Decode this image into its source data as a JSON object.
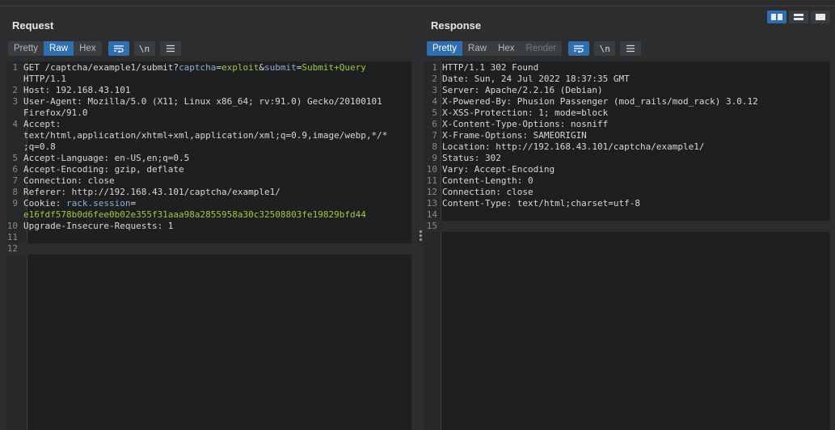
{
  "request": {
    "title": "Request",
    "tabs": [
      "Pretty",
      "Raw",
      "Hex"
    ],
    "selected_tab": "Raw",
    "wrap_icon": "wrap-lines-icon",
    "newline_label": "\\n",
    "menu_icon": "hamburger-menu-icon",
    "lines": [
      {
        "n": "1",
        "segs": [
          [
            "k",
            "GET /captcha/example1/submit?"
          ],
          [
            "pn",
            "captcha"
          ],
          [
            "k",
            "="
          ],
          [
            "pv",
            "exploit"
          ],
          [
            "k",
            "&"
          ],
          [
            "pn",
            "submit"
          ],
          [
            "k",
            "="
          ],
          [
            "pv",
            "Submit+Query"
          ]
        ]
      },
      {
        "n": "",
        "segs": [
          [
            "k",
            "HTTP/1.1"
          ]
        ]
      },
      {
        "n": "2",
        "segs": [
          [
            "k",
            "Host: 192.168.43.101"
          ]
        ]
      },
      {
        "n": "3",
        "segs": [
          [
            "k",
            "User-Agent: Mozilla/5.0 (X11; Linux x86_64; rv:91.0) Gecko/20100101"
          ]
        ]
      },
      {
        "n": "",
        "segs": [
          [
            "k",
            "Firefox/91.0"
          ]
        ]
      },
      {
        "n": "4",
        "segs": [
          [
            "k",
            "Accept:"
          ]
        ]
      },
      {
        "n": "",
        "segs": [
          [
            "k",
            "text/html,application/xhtml+xml,application/xml;q=0.9,image/webp,*/*"
          ]
        ]
      },
      {
        "n": "",
        "segs": [
          [
            "k",
            ";q=0.8"
          ]
        ]
      },
      {
        "n": "5",
        "segs": [
          [
            "k",
            "Accept-Language: en-US,en;q=0.5"
          ]
        ]
      },
      {
        "n": "6",
        "segs": [
          [
            "k",
            "Accept-Encoding: gzip, deflate"
          ]
        ]
      },
      {
        "n": "7",
        "segs": [
          [
            "k",
            "Connection: close"
          ]
        ]
      },
      {
        "n": "8",
        "segs": [
          [
            "k",
            "Referer: http://192.168.43.101/captcha/example1/"
          ]
        ]
      },
      {
        "n": "9",
        "segs": [
          [
            "k",
            "Cookie: "
          ],
          [
            "pn",
            "rack.session"
          ],
          [
            "k",
            "="
          ]
        ]
      },
      {
        "n": "",
        "segs": [
          [
            "pv",
            "e16fdf578b0d6fee0b02e355f31aaa98a2855958a30c32508803fe19829bfd44"
          ]
        ]
      },
      {
        "n": "10",
        "segs": [
          [
            "k",
            "Upgrade-Insecure-Requests: 1"
          ]
        ]
      },
      {
        "n": "11",
        "segs": []
      },
      {
        "n": "12",
        "segs": []
      }
    ]
  },
  "response": {
    "title": "Response",
    "tabs": [
      "Pretty",
      "Raw",
      "Hex",
      "Render"
    ],
    "selected_tab": "Pretty",
    "disabled_tab": "Render",
    "wrap_icon": "wrap-lines-icon",
    "newline_label": "\\n",
    "menu_icon": "hamburger-menu-icon",
    "lines": [
      {
        "n": "1",
        "segs": [
          [
            "k",
            "HTTP/1.1 302 Found"
          ]
        ]
      },
      {
        "n": "2",
        "segs": [
          [
            "k",
            "Date: Sun, 24 Jul 2022 18:37:35 GMT"
          ]
        ]
      },
      {
        "n": "3",
        "segs": [
          [
            "k",
            "Server: Apache/2.2.16 (Debian)"
          ]
        ]
      },
      {
        "n": "4",
        "segs": [
          [
            "k",
            "X-Powered-By: Phusion Passenger (mod_rails/mod_rack) 3.0.12"
          ]
        ]
      },
      {
        "n": "5",
        "segs": [
          [
            "k",
            "X-XSS-Protection: 1; mode=block"
          ]
        ]
      },
      {
        "n": "6",
        "segs": [
          [
            "k",
            "X-Content-Type-Options: nosniff"
          ]
        ]
      },
      {
        "n": "7",
        "segs": [
          [
            "k",
            "X-Frame-Options: SAMEORIGIN"
          ]
        ]
      },
      {
        "n": "8",
        "segs": [
          [
            "k",
            "Location: http://192.168.43.101/captcha/example1/"
          ]
        ]
      },
      {
        "n": "9",
        "segs": [
          [
            "k",
            "Status: 302"
          ]
        ]
      },
      {
        "n": "10",
        "segs": [
          [
            "k",
            "Vary: Accept-Encoding"
          ]
        ]
      },
      {
        "n": "11",
        "segs": [
          [
            "k",
            "Content-Length: 0"
          ]
        ]
      },
      {
        "n": "12",
        "segs": [
          [
            "k",
            "Connection: close"
          ]
        ]
      },
      {
        "n": "13",
        "segs": [
          [
            "k",
            "Content-Type: text/html;charset=utf-8"
          ]
        ]
      },
      {
        "n": "14",
        "segs": []
      },
      {
        "n": "15",
        "segs": []
      }
    ]
  },
  "layout_buttons": [
    "side-by-side-layout-icon",
    "stacked-layout-icon",
    "single-pane-layout-icon"
  ],
  "colors": {
    "accent": "#2f6fb0",
    "param_value": "#9ccc3d",
    "param_name": "#8fb0d8",
    "editor_bg": "#1e1f21"
  }
}
